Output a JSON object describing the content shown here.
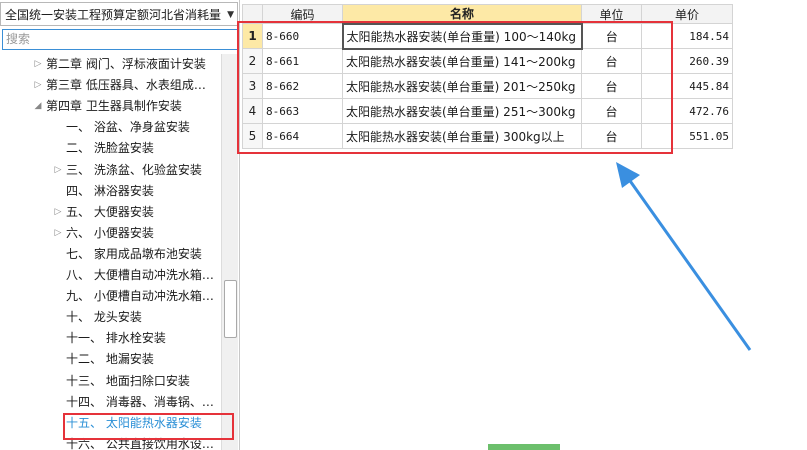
{
  "quota_selector": {
    "value": "全国统一安装工程预算定额河北省消耗量"
  },
  "search": {
    "placeholder": "搜索"
  },
  "tree": [
    {
      "label": "第二章  阀门、浮标液面计安装",
      "expandable": true
    },
    {
      "label": "第三章  低压器具、水表组成…",
      "expandable": true
    },
    {
      "label": "第四章  卫生器具制作安装",
      "expanded": true
    },
    {
      "label": "一、  浴盆、净身盆安装"
    },
    {
      "label": "二、  洗脸盆安装"
    },
    {
      "label": "三、  洗涤盆、化验盆安装",
      "expandable": true
    },
    {
      "label": "四、  淋浴器安装"
    },
    {
      "label": "五、  大便器安装",
      "expandable": true
    },
    {
      "label": "六、  小便器安装",
      "expandable": true
    },
    {
      "label": "七、  家用成品墩布池安装"
    },
    {
      "label": "八、  大便槽自动冲洗水箱…"
    },
    {
      "label": "九、  小便槽自动冲洗水箱…"
    },
    {
      "label": "十、  龙头安装"
    },
    {
      "label": "十一、  排水栓安装"
    },
    {
      "label": "十二、  地漏安装"
    },
    {
      "label": "十三、  地面扫除口安装"
    },
    {
      "label": "十四、  消毒器、消毒锅、…"
    },
    {
      "label": "十五、  太阳能热水器安装",
      "selected": true
    },
    {
      "label": "十六、  公共直接饮用水设…"
    }
  ],
  "grid": {
    "headers": {
      "code": "编码",
      "name": "名称",
      "unit": "单位",
      "price": "单价"
    },
    "rows": [
      {
        "index": "1",
        "code": "8-660",
        "name": "太阳能热水器安装(单台重量) 100～140kg",
        "unit": "台",
        "price": "184.54"
      },
      {
        "index": "2",
        "code": "8-661",
        "name": "太阳能热水器安装(单台重量) 141～200kg",
        "unit": "台",
        "price": "260.39"
      },
      {
        "index": "3",
        "code": "8-662",
        "name": "太阳能热水器安装(单台重量) 201～250kg",
        "unit": "台",
        "price": "445.84"
      },
      {
        "index": "4",
        "code": "8-663",
        "name": "太阳能热水器安装(单台重量) 251～300kg",
        "unit": "台",
        "price": "472.76"
      },
      {
        "index": "5",
        "code": "8-664",
        "name": "太阳能热水器安装(单台重量) 300kg以上",
        "unit": "台",
        "price": "551.05"
      }
    ]
  },
  "colors": {
    "highlight_box": "#e5323a",
    "arrow": "#3a8fe0",
    "selected_text": "#2a8fd6",
    "active_header": "#fde9a6"
  }
}
